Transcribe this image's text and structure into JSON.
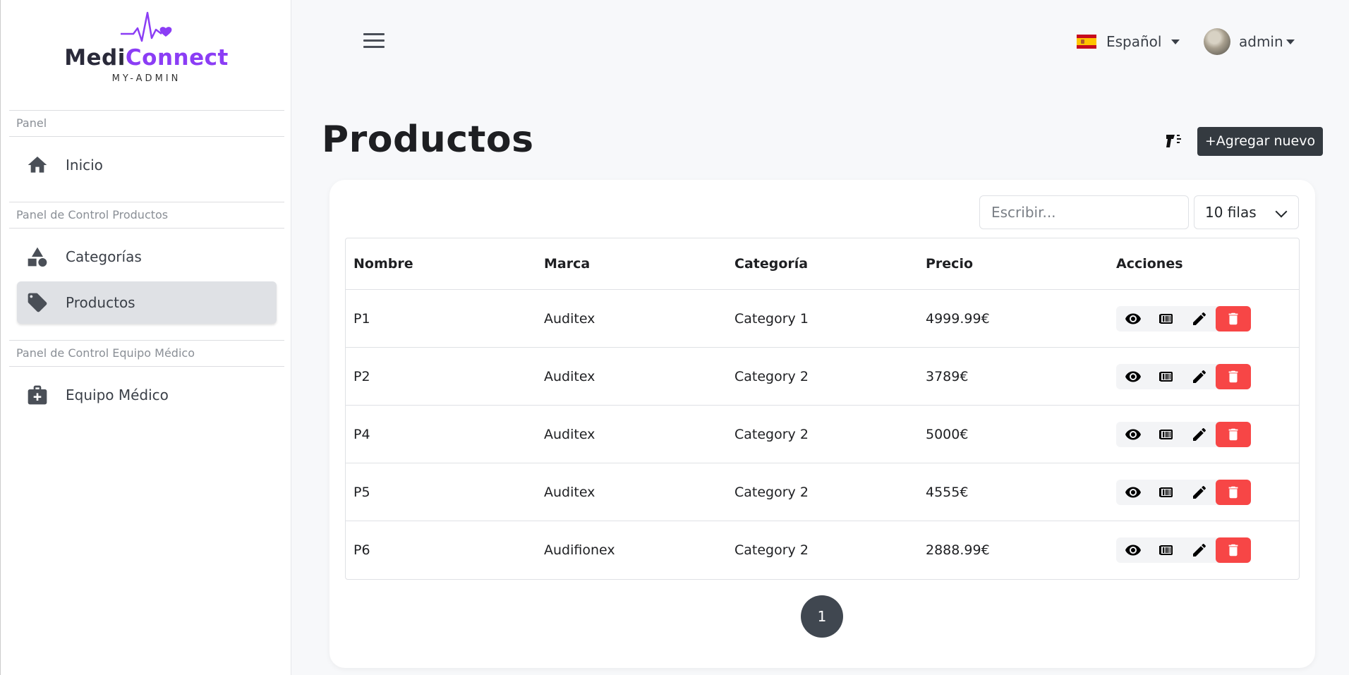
{
  "brand": {
    "name_part1": "Medi",
    "name_part2": "Connect",
    "subtitle": "MY-ADMIN",
    "accent": "#8b3df5"
  },
  "sidebar": {
    "sections": [
      {
        "label": "Panel",
        "items": [
          {
            "label": "Inicio",
            "icon": "home-icon"
          }
        ]
      },
      {
        "label": "Panel de Control Productos",
        "items": [
          {
            "label": "Categorías",
            "icon": "shapes-icon"
          },
          {
            "label": "Productos",
            "icon": "tag-icon",
            "active": true
          }
        ]
      },
      {
        "label": "Panel de Control Equipo Médico",
        "items": [
          {
            "label": "Equipo Médico",
            "icon": "medical-kit-icon"
          }
        ]
      }
    ]
  },
  "topbar": {
    "language": "Español",
    "user": "admin"
  },
  "page": {
    "title": "Productos",
    "add_button": "+Agregar nuevo"
  },
  "table_controls": {
    "search_placeholder": "Escribir...",
    "rows_per_page": "10 filas"
  },
  "table": {
    "headers": [
      "Nombre",
      "Marca",
      "Categoría",
      "Precio",
      "Acciones"
    ],
    "rows": [
      [
        "P1",
        "Auditex",
        "Category 1",
        "4999.99€"
      ],
      [
        "P2",
        "Auditex",
        "Category 2",
        "3789€"
      ],
      [
        "P4",
        "Auditex",
        "Category 2",
        "5000€"
      ],
      [
        "P5",
        "Auditex",
        "Category 2",
        "4555€"
      ],
      [
        "P6",
        "Audifionex",
        "Category 2",
        "2888.99€"
      ]
    ],
    "row_actions": [
      "view-icon",
      "barcode-icon",
      "edit-icon",
      "delete-icon"
    ]
  },
  "pagination": {
    "current_page": "1"
  },
  "colors": {
    "delete": "#f74646",
    "dark_button": "#343a40",
    "active_nav": "#dfe1e5"
  }
}
